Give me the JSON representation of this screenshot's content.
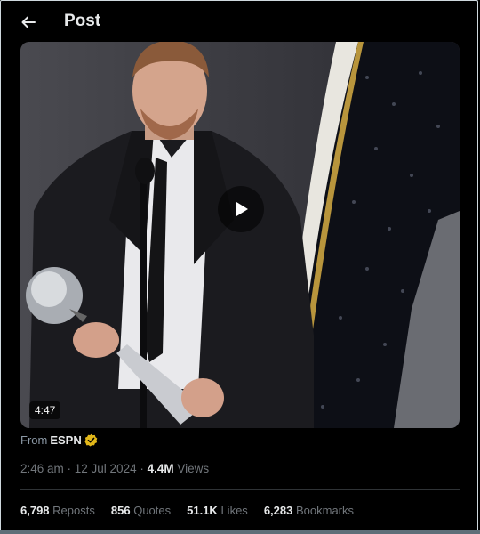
{
  "header": {
    "title": "Post",
    "back_icon": "back-arrow-icon"
  },
  "media": {
    "duration": "4:47",
    "play_icon": "play-icon"
  },
  "source": {
    "prefix": "From",
    "name": "ESPN",
    "verified_icon": "verified-badge-icon",
    "verified_color": "#e2b719"
  },
  "meta": {
    "time_date": "2:46 am · 12 Jul 2024 · ",
    "views_count": "4.4M",
    "views_label": "Views"
  },
  "stats": [
    {
      "count": "6,798",
      "label": "Reposts"
    },
    {
      "count": "856",
      "label": "Quotes"
    },
    {
      "count": "51.1K",
      "label": "Likes"
    },
    {
      "count": "6,283",
      "label": "Bookmarks"
    }
  ],
  "colors": {
    "background": "#000000",
    "text_primary": "#e7e9ea",
    "text_secondary": "#71767b",
    "divider": "#2f3336"
  }
}
